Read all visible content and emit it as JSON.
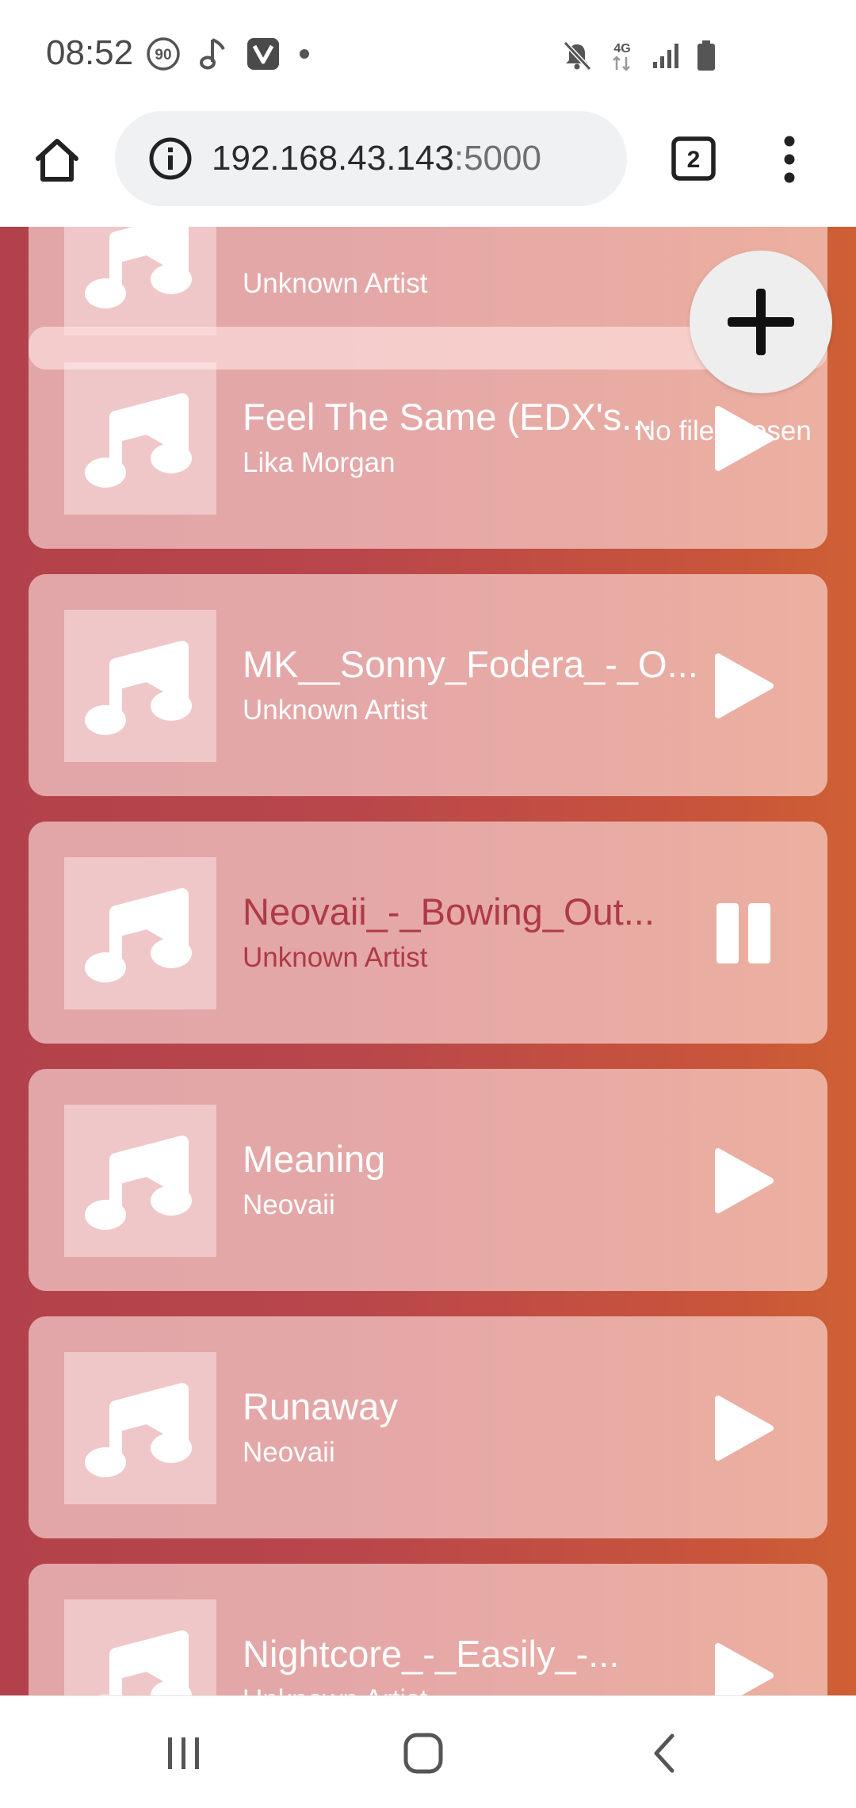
{
  "status_bar": {
    "time": "08:52",
    "icons_left": [
      "data-saver-90-icon",
      "music-note-icon",
      "vivaldi-icon",
      "dot-icon"
    ],
    "icons_right": [
      "mute-icon",
      "4g-icon",
      "signal-icon",
      "battery-icon"
    ],
    "badge_text": "90",
    "network_text": "4G"
  },
  "browser": {
    "url_host": "192.168.43.143",
    "url_port": ":5000",
    "tab_count": "2"
  },
  "upload": {
    "file_status": "No file chosen"
  },
  "songs": [
    {
      "title": "",
      "artist": "Unknown Artist",
      "state": "play"
    },
    {
      "title": "Feel The Same (EDX's...",
      "artist": "Lika Morgan",
      "state": "play"
    },
    {
      "title": "MK__Sonny_Fodera_-_O...",
      "artist": "Unknown Artist",
      "state": "play"
    },
    {
      "title": "Neovaii_-_Bowing_Out...",
      "artist": "Unknown Artist",
      "state": "pause"
    },
    {
      "title": "Meaning",
      "artist": "Neovaii",
      "state": "play"
    },
    {
      "title": "Runaway",
      "artist": "Neovaii",
      "state": "play"
    },
    {
      "title": "Nightcore_-_Easily_-...",
      "artist": "Unknown Artist",
      "state": "play"
    }
  ],
  "colors": {
    "active_text": "#ae3a46",
    "gradient_left": "#b2414b",
    "gradient_right": "#ce6034"
  }
}
